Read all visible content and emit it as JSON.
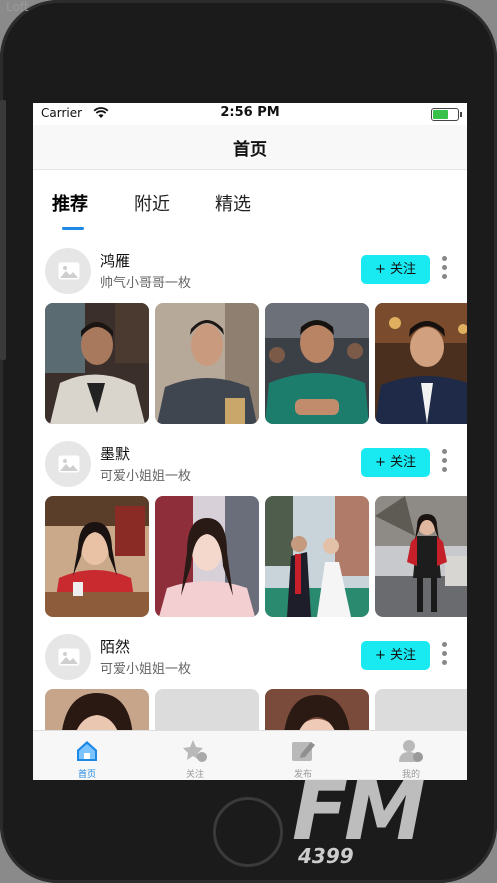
{
  "watermark_top": "Loft",
  "status": {
    "carrier": "Carrier",
    "time": "2:56 PM",
    "battery_level": 0.7
  },
  "nav": {
    "title": "首页"
  },
  "tabs": [
    {
      "label": "推荐",
      "active": true
    },
    {
      "label": "附近",
      "active": false
    },
    {
      "label": "精选",
      "active": false
    }
  ],
  "posts": [
    {
      "name": "鸿雁",
      "desc": "帅气小哥哥一枚",
      "follow_label": "+ 关注",
      "photos": [
        "man-white-jacket-photo",
        "man-grey-sweater-photo",
        "man-green-shirt-photo",
        "man-navy-suit-photo"
      ]
    },
    {
      "name": "墨默",
      "desc": "可爱小姐姐一枚",
      "follow_label": "+ 关注",
      "photos": [
        "girl-red-sweater-cafe-photo",
        "girl-pink-top-photo",
        "wedding-couple-photo",
        "girl-red-jacket-street-photo"
      ]
    },
    {
      "name": "陌然",
      "desc": "可爱小姐姐一枚",
      "follow_label": "+ 关注",
      "photos": [
        "girl-selfie-photo",
        "blank-photo",
        "girl-selfie-2-photo",
        "blank-photo"
      ]
    }
  ],
  "tabbar": [
    {
      "label": "首页",
      "icon": "home-icon",
      "active": true
    },
    {
      "label": "关注",
      "icon": "star-icon",
      "active": false
    },
    {
      "label": "发布",
      "icon": "edit-icon",
      "active": false
    },
    {
      "label": "我的",
      "icon": "user-icon",
      "active": false
    }
  ],
  "watermark": {
    "brand": "FM",
    "sub": "4399"
  },
  "colors": {
    "accent": "#1e88e5",
    "follow_button": "#19eaf2",
    "indicator": "#1e88e5"
  }
}
